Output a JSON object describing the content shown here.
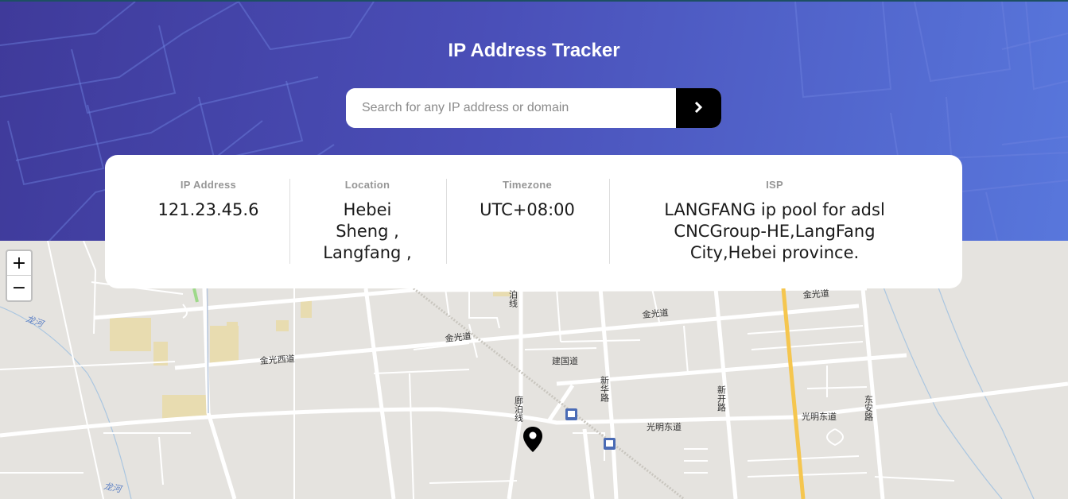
{
  "header": {
    "title": "IP Address Tracker",
    "search_placeholder": "Search for any IP address or domain",
    "search_value": "",
    "submit_icon": "chevron-right-icon"
  },
  "info": {
    "ip_label": "IP Address",
    "ip_value": "121.23.45.6",
    "location_label": "Location",
    "location_value_lines": [
      "Hebei",
      "Sheng ,",
      "Langfang ,"
    ],
    "timezone_label": "Timezone",
    "timezone_value": "UTC+08:00",
    "isp_label": "ISP",
    "isp_value_lines": [
      "LANGFANG ip pool for adsl",
      "CNCGroup-HE,LangFang",
      "City,Hebei province."
    ]
  },
  "map": {
    "zoom_in": "+",
    "zoom_out": "−",
    "marker_icon": "location-pin-icon",
    "labels": {
      "jinguang_1": "金光道",
      "jinguang_2": "金光道",
      "jinguang_3": "金光道",
      "jinguang_west": "金光西道",
      "jianguo": "建国道",
      "guangming_east_1": "光明东道",
      "guangming_east_2": "光明东道",
      "xinhua_road": "新华路",
      "xinkai_road": "新开路",
      "dongan_road": "东安路",
      "langbo_line_1": "泊线",
      "langbo_line_2": "廊泊线",
      "longhe_1": "龙河",
      "longhe_2": "龙河"
    }
  },
  "colors": {
    "header_start": "#3f3a9a",
    "header_end": "#5877dc",
    "map_bg": "#e5e3df",
    "road_major": "#f5c64f",
    "water": "#aac6e0"
  }
}
